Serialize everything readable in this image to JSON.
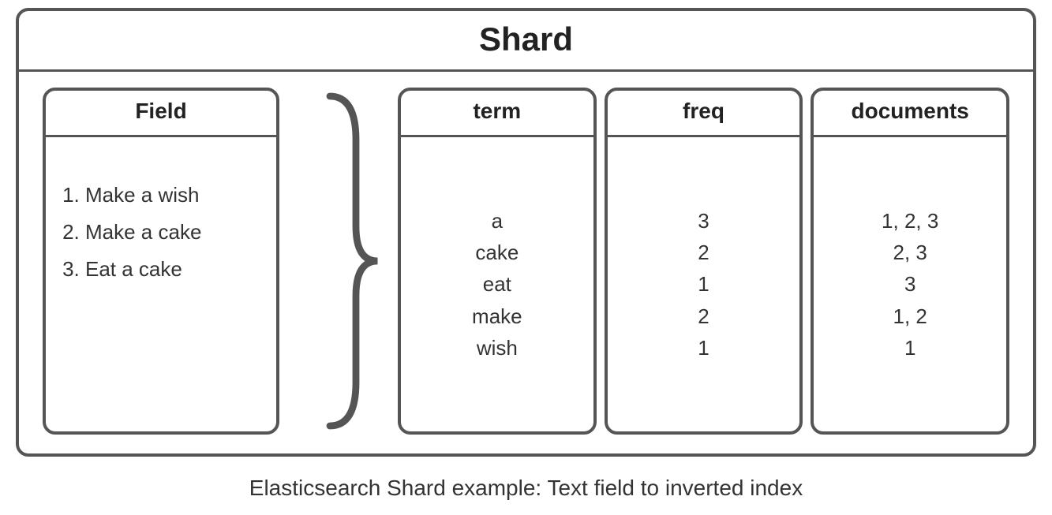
{
  "title": "Shard",
  "field_header": "Field",
  "docs": [
    "Make a wish",
    "Make a cake",
    "Eat a cake"
  ],
  "columns": {
    "term": {
      "header": "term",
      "rows": [
        "a",
        "cake",
        "eat",
        "make",
        "wish"
      ]
    },
    "freq": {
      "header": "freq",
      "rows": [
        "3",
        "2",
        "1",
        "2",
        "1"
      ]
    },
    "documents": {
      "header": "documents",
      "rows": [
        "1, 2, 3",
        "2, 3",
        "3",
        "1, 2",
        "1"
      ]
    }
  },
  "caption": "Elasticsearch Shard example: Text field to inverted index"
}
